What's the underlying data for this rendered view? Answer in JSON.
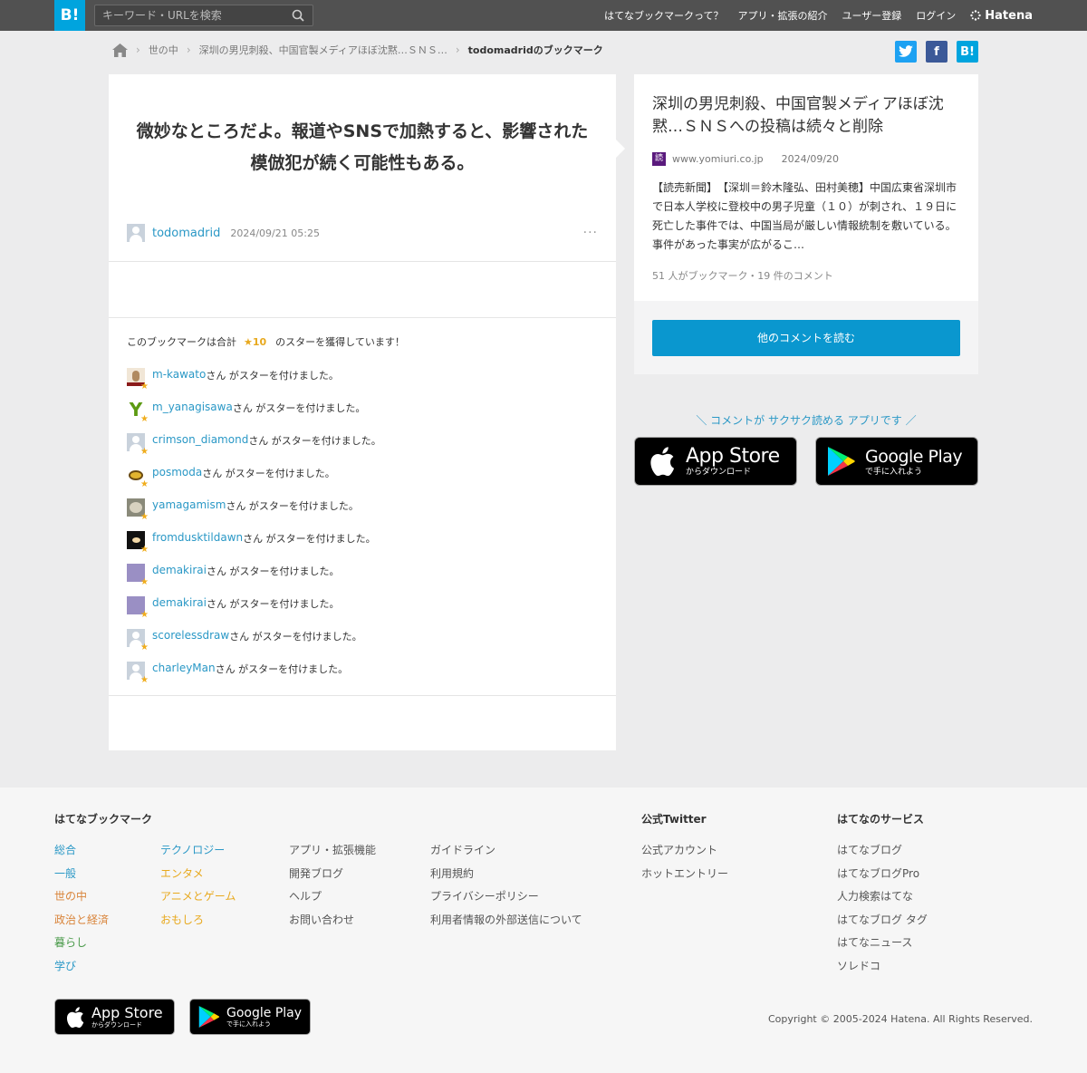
{
  "header": {
    "logo": "B!",
    "search_placeholder": "キーワード・URLを検索",
    "nav": [
      "はてなブックマークって？",
      "アプリ・拡張の紹介",
      "ユーザー登録",
      "ログイン"
    ],
    "hatena": "Hatena"
  },
  "breadcrumb": {
    "items": [
      "世の中",
      "深圳の男児刺殺、中国官製メディアほぼ沈黙…ＳＮＳ…",
      "todomadridのブックマーク"
    ]
  },
  "share": {
    "twitter": "t",
    "facebook": "f",
    "hatebu": "B!"
  },
  "bookmark": {
    "comment": "微妙なところだよ。報道やSNSで加熱すると、影響された模倣犯が続く可能性もある。",
    "user": "todomadrid",
    "timestamp": "2024/09/21 05:25",
    "more": "···"
  },
  "stars": {
    "prefix": "このブックマークは合計",
    "count": "★10",
    "suffix": "のスターを獲得しています！",
    "action_text": "さん がスターを付けました。",
    "givers": [
      {
        "user": "m-kawato",
        "icon": "cat-avatar-icon"
      },
      {
        "user": "m_yanagisawa",
        "icon": "y-letter-avatar-icon"
      },
      {
        "user": "crimson_diamond",
        "icon": "default-avatar-icon"
      },
      {
        "user": "posmoda",
        "icon": "pudding-avatar-icon"
      },
      {
        "user": "yamagamism",
        "icon": "cat-face-avatar-icon"
      },
      {
        "user": "fromdusktildawn",
        "icon": "galaxy-avatar-icon"
      },
      {
        "user": "demakirai",
        "icon": "purple-avatar-icon"
      },
      {
        "user": "demakirai",
        "icon": "purple-avatar-icon"
      },
      {
        "user": "scorelessdraw",
        "icon": "default-avatar-icon"
      },
      {
        "user": "charleyMan",
        "icon": "default-avatar-icon"
      }
    ]
  },
  "article": {
    "title": "深圳の男児刺殺、中国官製メディアほぼ沈黙…ＳＮＳへの投稿は続々と削除",
    "favicon": "読",
    "domain": "www.yomiuri.co.jp",
    "date": "2024/09/20",
    "excerpt": "【読売新聞】　【深圳＝鈴木隆弘、田村美穂】中国広東省深圳市で日本人学校に登校中の男子児童（１０）が刺され、１９日に死亡した事件では、中国当局が厳しい情報統制を敷いている。事件があった事実が広がるこ…",
    "counts": "51 人がブックマーク・19 件のコメント",
    "read_button": "他のコメントを読む"
  },
  "promo": {
    "text": "＼ コメントが サクサク読める アプリです ／",
    "appstore_big": "App Store",
    "appstore_small": "からダウンロード",
    "googleplay_big": "Google Play",
    "googleplay_small": "で手に入れよう"
  },
  "footer": {
    "heading_bookmark": "はてなブックマーク",
    "col1": [
      "総合",
      "一般",
      "世の中",
      "政治と経済",
      "暮らし",
      "学び"
    ],
    "col2": [
      "テクノロジー",
      "エンタメ",
      "アニメとゲーム",
      "おもしろ"
    ],
    "col3": [
      "アプリ・拡張機能",
      "開発ブログ",
      "ヘルプ",
      "お問い合わせ"
    ],
    "col4": [
      "ガイドライン",
      "利用規約",
      "プライバシーポリシー",
      "利用者情報の外部送信について"
    ],
    "heading_twitter": "公式Twitter",
    "col5": [
      "公式アカウント",
      "ホットエントリー"
    ],
    "heading_services": "はてなのサービス",
    "col6": [
      "はてなブログ",
      "はてなブログPro",
      "人力検索はてな",
      "はてなブログ タグ",
      "はてなニュース",
      "ソレドコ"
    ],
    "copyright": "Copyright © 2005-2024 Hatena. All Rights Reserved."
  },
  "colors": {
    "brand": "#00a4de",
    "link": "#2a98c6",
    "star": "#f0ad1c",
    "col1": [
      "#2a98c6",
      "#2a98c6",
      "#d9843a",
      "#d9843a",
      "#4a9a4a",
      "#2a98c6"
    ],
    "col2": [
      "#2a98c6",
      "#e8a91e",
      "#e8a91e",
      "#e8a91e"
    ]
  }
}
